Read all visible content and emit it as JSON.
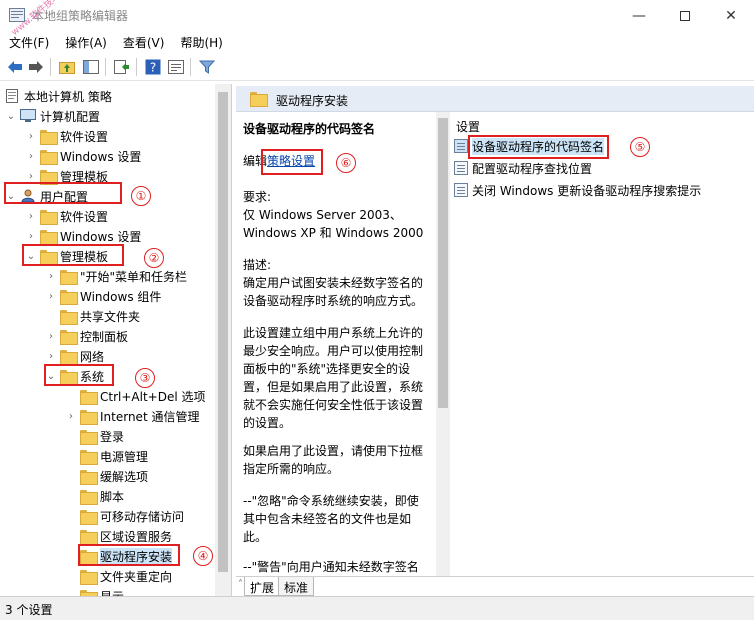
{
  "window": {
    "title": "本地组策略编辑器",
    "watermark": "www.软件技巧",
    "min_icon": "minimize-icon",
    "max_icon": "maximize-icon",
    "close_icon": "close-icon"
  },
  "menu": [
    {
      "label": "文件(F)"
    },
    {
      "label": "操作(A)"
    },
    {
      "label": "查看(V)"
    },
    {
      "label": "帮助(H)"
    }
  ],
  "toolbar": {
    "icons": [
      "back-arrow-icon",
      "forward-arrow-icon",
      "up-folder-icon",
      "show-hide-tree-icon",
      "export-list-icon",
      "help-icon",
      "properties-icon",
      "filter-icon"
    ]
  },
  "tree": {
    "root": "本地计算机 策略",
    "items": [
      {
        "label": "计算机配置"
      },
      {
        "label": "软件设置"
      },
      {
        "label": "Windows 设置"
      },
      {
        "label": "管理模板"
      },
      {
        "label": "用户配置"
      },
      {
        "label": "软件设置"
      },
      {
        "label": "Windows 设置"
      },
      {
        "label": "管理模板"
      },
      {
        "label": "\"开始\"菜单和任务栏"
      },
      {
        "label": "Windows 组件"
      },
      {
        "label": "共享文件夹"
      },
      {
        "label": "控制面板"
      },
      {
        "label": "网络"
      },
      {
        "label": "系统"
      },
      {
        "label": "Ctrl+Alt+Del 选项"
      },
      {
        "label": "Internet 通信管理"
      },
      {
        "label": "登录"
      },
      {
        "label": "电源管理"
      },
      {
        "label": "缓解选项"
      },
      {
        "label": "脚本"
      },
      {
        "label": "可移动存储访问"
      },
      {
        "label": "区域设置服务"
      },
      {
        "label": "驱动程序安装"
      },
      {
        "label": "文件夹重定向"
      },
      {
        "label": "显示"
      }
    ]
  },
  "annotations": [
    "①",
    "②",
    "③",
    "④",
    "⑤",
    "⑥"
  ],
  "right_header": {
    "title": "驱动程序安装"
  },
  "description": {
    "title": "设备驱动程序的代码签名",
    "edit_prefix": "编辑",
    "edit_link": "策略设置",
    "requirements_label": "要求:",
    "requirements_line1": "仅 Windows Server 2003、",
    "requirements_line2": "Windows XP 和 Windows 2000",
    "desc_label": "描述:",
    "desc_lines": [
      "确定用户试图安装未经数字签名的",
      "设备驱动程序时系统的响应方式。"
    ],
    "para2_lines": [
      "此设置建立组中用户系统上允许的",
      "最少安全响应。用户可以使用控制",
      "面板中的\"系统\"选择更安全的设",
      "置，但是如果启用了此设置，系统",
      "就不会实施任何安全性低于该设置",
      "的设置。"
    ],
    "para3_lines": [
      "如果启用了此设置，请使用下拉框",
      "指定所需的响应。"
    ],
    "para4_lines": [
      "--\"忽略\"命令系统继续安装，即使",
      "其中包含未经签名的文件也是如",
      "此。"
    ],
    "para5_lines": [
      "--\"警告\"向用户通知未经数字签名"
    ]
  },
  "settings": {
    "column_header": "设置",
    "rows": [
      {
        "label": "设备驱动程序的代码签名"
      },
      {
        "label": "配置驱动程序查找位置"
      },
      {
        "label": "关闭 Windows 更新设备驱动程序搜索提示"
      }
    ]
  },
  "tabs": [
    {
      "label": "扩展"
    },
    {
      "label": "标准"
    }
  ],
  "status": {
    "text": "3 个设置"
  }
}
